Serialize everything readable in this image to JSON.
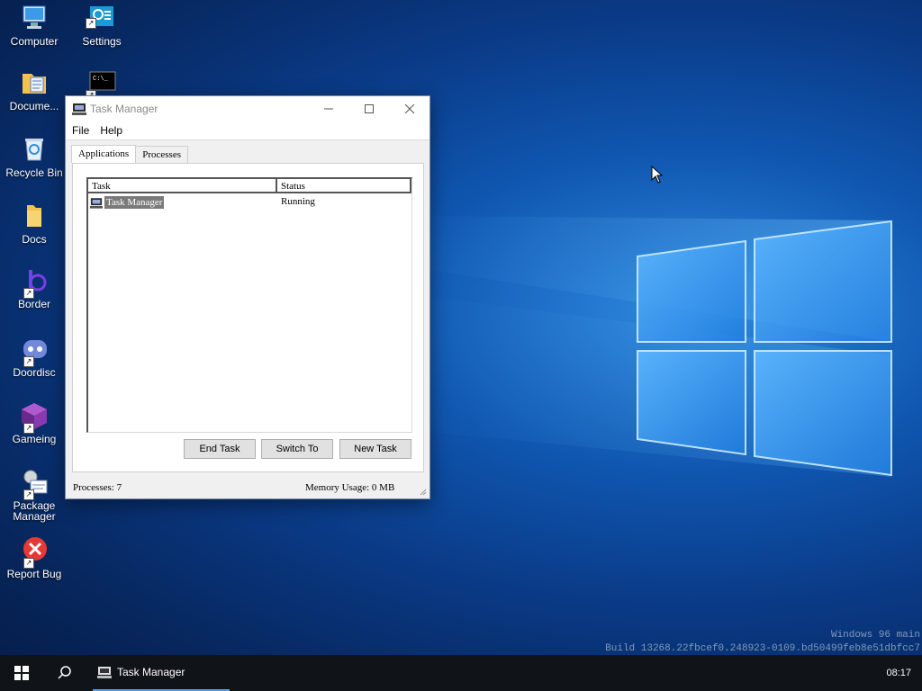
{
  "desktop": {
    "icons": [
      {
        "label": "Computer",
        "icon": "computer-icon"
      },
      {
        "label": "Settings",
        "icon": "settings-icon"
      },
      {
        "label": "Docume...",
        "icon": "documents-folder-icon"
      },
      {
        "label": "",
        "icon": "terminal-icon"
      },
      {
        "label": "Recycle Bin",
        "icon": "recycle-bin-icon"
      },
      {
        "label": "Docs",
        "icon": "docs-folder-icon"
      },
      {
        "label": "Border",
        "icon": "border-app-icon"
      },
      {
        "label": "Doordisc",
        "icon": "doordisc-icon"
      },
      {
        "label": "Gameing",
        "icon": "gameing-cube-icon"
      },
      {
        "label": "Package Manager",
        "icon": "package-manager-icon"
      },
      {
        "label": "Report Bug",
        "icon": "report-bug-icon"
      }
    ]
  },
  "window": {
    "title": "Task Manager",
    "menu": [
      "File",
      "Help"
    ],
    "tabs": [
      "Applications",
      "Processes"
    ],
    "active_tab": "Applications",
    "columns": [
      "Task",
      "Status"
    ],
    "rows": [
      {
        "task": "Task Manager",
        "status": "Running"
      }
    ],
    "buttons": {
      "end_task": "End Task",
      "switch_to": "Switch To",
      "new_task": "New Task"
    },
    "status": {
      "processes": "Processes: 7",
      "memory": "Memory Usage: 0 MB"
    }
  },
  "watermark": {
    "line1": "Windows 96 main",
    "line2": "Build 13268.22fbcef0.248923-0109.bd50499feb8e51dbfcc7"
  },
  "taskbar": {
    "task_label": "Task Manager",
    "clock": "08:17"
  },
  "colors": {
    "accent": "#4f9ee8",
    "taskbar": "#101419"
  }
}
